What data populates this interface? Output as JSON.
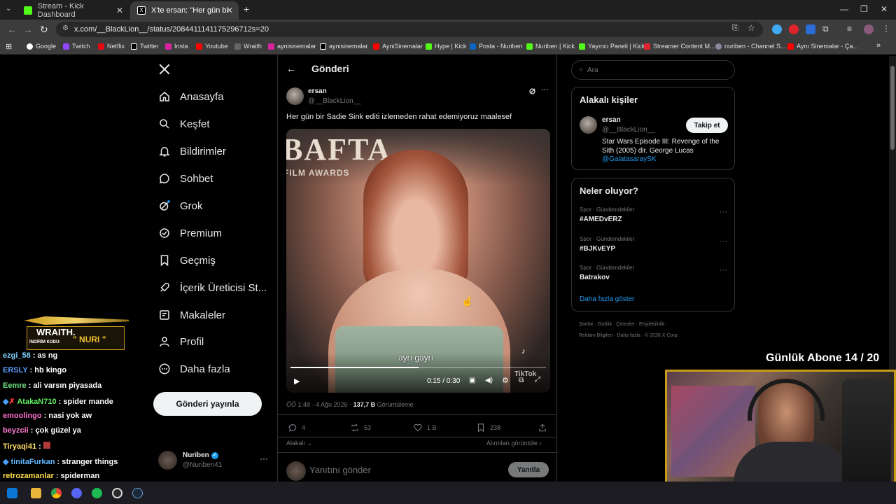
{
  "browser": {
    "tabs": [
      {
        "title": "Stream - Kick Dashboard",
        "color": "#53fc18"
      },
      {
        "title": "X'te ersan: \"Her gün bir Sad",
        "color": "#ffffff"
      }
    ],
    "url": "x.com/__BlackLion__/status/2084411141175296712s=20",
    "bookmarks": [
      "Google",
      "Twitch",
      "Netflix",
      "Twitter",
      "Insta",
      "Youtube",
      "Wraith",
      "aynisinemalar",
      "aynisinemalar",
      "AyniSinemalar",
      "Hype | Kick",
      "Posta - Nuriben",
      "Nuriben | Kick",
      "Yayıncı Paneli | Kick",
      "Streamer Content M...",
      "nuriben - Channel S...",
      "Aynı Sinemalar - Ça..."
    ]
  },
  "sidebar": {
    "items": [
      {
        "label": "Anasayfa",
        "icon": "home-icon"
      },
      {
        "label": "Keşfet",
        "icon": "search-icon"
      },
      {
        "label": "Bildirimler",
        "icon": "bell-icon"
      },
      {
        "label": "Sohbet",
        "icon": "chat-icon"
      },
      {
        "label": "Grok",
        "icon": "grok-icon"
      },
      {
        "label": "Premium",
        "icon": "verified-icon"
      },
      {
        "label": "Geçmiş",
        "icon": "bookmark-icon"
      },
      {
        "label": "İçerik Üreticisi St...",
        "icon": "rocket-icon"
      },
      {
        "label": "Makaleler",
        "icon": "article-icon"
      },
      {
        "label": "Profil",
        "icon": "person-icon"
      },
      {
        "label": "Daha fazla",
        "icon": "more-circle-icon"
      }
    ],
    "post_button": "Gönderi yayınla",
    "account": {
      "name": "Nuriben",
      "handle": "@Nuriben41"
    }
  },
  "post": {
    "header": "Gönderi",
    "author_name": "ersan",
    "author_handle": "@__BlackLion__",
    "text": "Her gün bir Sadie Sink editi izlemeden rahat edemiyoruz maalesef",
    "video": {
      "caption": "ayrı gayrı",
      "time": "0:15 / 0:30",
      "progress": 0.5,
      "backdrop": "BAFTA",
      "backdrop_sub": "FILM AWARDS",
      "watermark": "TikTok"
    },
    "timestamp": "ÖÖ 1:48 · 4 Ağu 2026 · ",
    "views_count": "137,7 B",
    "views_label": "Görüntüleme",
    "replies": "4",
    "reposts": "53",
    "likes": "1 B",
    "bookmarks": "238",
    "sort_label": "Alakalı",
    "quotes_link": "Alıntıları görüntüle",
    "reply_placeholder": "Yanıtını gönder",
    "reply_button": "Yanıtla"
  },
  "right": {
    "search_placeholder": "Ara",
    "relevant_title": "Alakalı kişiler",
    "person": {
      "name": "ersan",
      "handle": "@__BlackLion__",
      "bio": "Star Wars Episode III: Revenge of the Sith (2005) dir. George Lucas",
      "bio_link": "@GalatasaraySK",
      "follow": "Takip et"
    },
    "trends_title": "Neler oluyor?",
    "trends": [
      {
        "category": "Spor · Gündemdekiler",
        "name": "#AMEDvERZ"
      },
      {
        "category": "Spor · Gündemdekiler",
        "name": "#BJKvEYP"
      },
      {
        "category": "Spor · Gündemdekiler",
        "name": "Batrakov"
      }
    ],
    "show_more": "Daha fazla göster",
    "footer_line1": "Şartlar  ·  Gizlilik  ·  Çerezler  ·  Erişilebilirlik  ·",
    "footer_line2": "Reklam Bilgileri  ·  Daha fazla  ·  © 2026 X Corp."
  },
  "stream": {
    "sponsor_name": "WRAITH.",
    "sponsor_code_label": "İNDİRİM KODU:",
    "sponsor_code": "\" NURI \"",
    "sub_counter": "Günlük Abone 14 / 20",
    "chat": [
      {
        "user": "ezgi_58",
        "color": "#7fd0ff",
        "msg": ": as ng"
      },
      {
        "user": "ERSLY",
        "color": "#5aa0ff",
        "msg": ": hb kingo"
      },
      {
        "user": "Eemre",
        "color": "#6fe07f",
        "msg": ": ali varsın piyasada"
      },
      {
        "user": "AtakaN710",
        "color": "#5ef05e",
        "msg": ": spider mande"
      },
      {
        "user": "emoolingo",
        "color": "#ff6fd0",
        "msg": ": nasi yok aw"
      },
      {
        "user": "beyzcii",
        "color": "#ff7ad0",
        "msg": ": çok güzel ya"
      },
      {
        "user": "Tiryaqi41",
        "color": "#ffe06a",
        "msg": ":"
      },
      {
        "user": "tinitaFurkan",
        "color": "#5fb8ff",
        "msg": ": stranger things"
      },
      {
        "user": "retrozamanlar",
        "color": "#ffe04a",
        "msg": ": spiderman"
      }
    ]
  }
}
